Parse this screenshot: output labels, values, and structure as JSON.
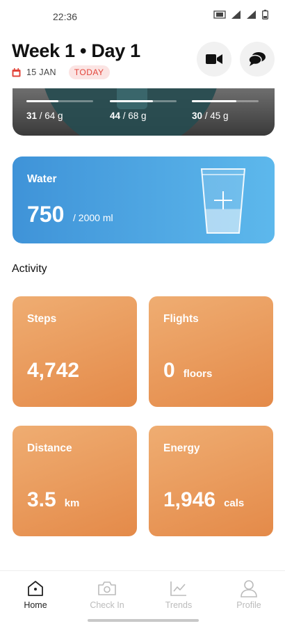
{
  "status_bar": {
    "time": "22:36"
  },
  "header": {
    "title": "Week 1 • Day 1",
    "date": "15 JAN",
    "today_badge": "TODAY"
  },
  "macros": [
    {
      "current": "31",
      "goal": " / 64 g",
      "progress": 0.484
    },
    {
      "current": "44",
      "goal": " / 68 g",
      "progress": 0.647
    },
    {
      "current": "30",
      "goal": " / 45 g",
      "progress": 0.667
    }
  ],
  "water": {
    "label": "Water",
    "value": "750",
    "goal": "/ 2000 ml",
    "progress": 0.375
  },
  "activity": {
    "title": "Activity",
    "cards": [
      {
        "label": "Steps",
        "value": "4,742",
        "unit": ""
      },
      {
        "label": "Flights",
        "value": "0",
        "unit": "floors"
      },
      {
        "label": "Distance",
        "value": "3.5",
        "unit": "km"
      },
      {
        "label": "Energy",
        "value": "1,946",
        "unit": "cals"
      }
    ]
  },
  "nav": [
    {
      "label": "Home",
      "icon": "home-icon",
      "active": true
    },
    {
      "label": "Check In",
      "icon": "camera-icon",
      "active": false
    },
    {
      "label": "Trends",
      "icon": "chart-icon",
      "active": false
    },
    {
      "label": "Profile",
      "icon": "profile-icon",
      "active": false
    }
  ],
  "colors": {
    "water_card": "#4aa3e0",
    "activity_card": "#e99a5a",
    "today_badge": "#e2453b",
    "macro_card": "#4a4a4a"
  }
}
